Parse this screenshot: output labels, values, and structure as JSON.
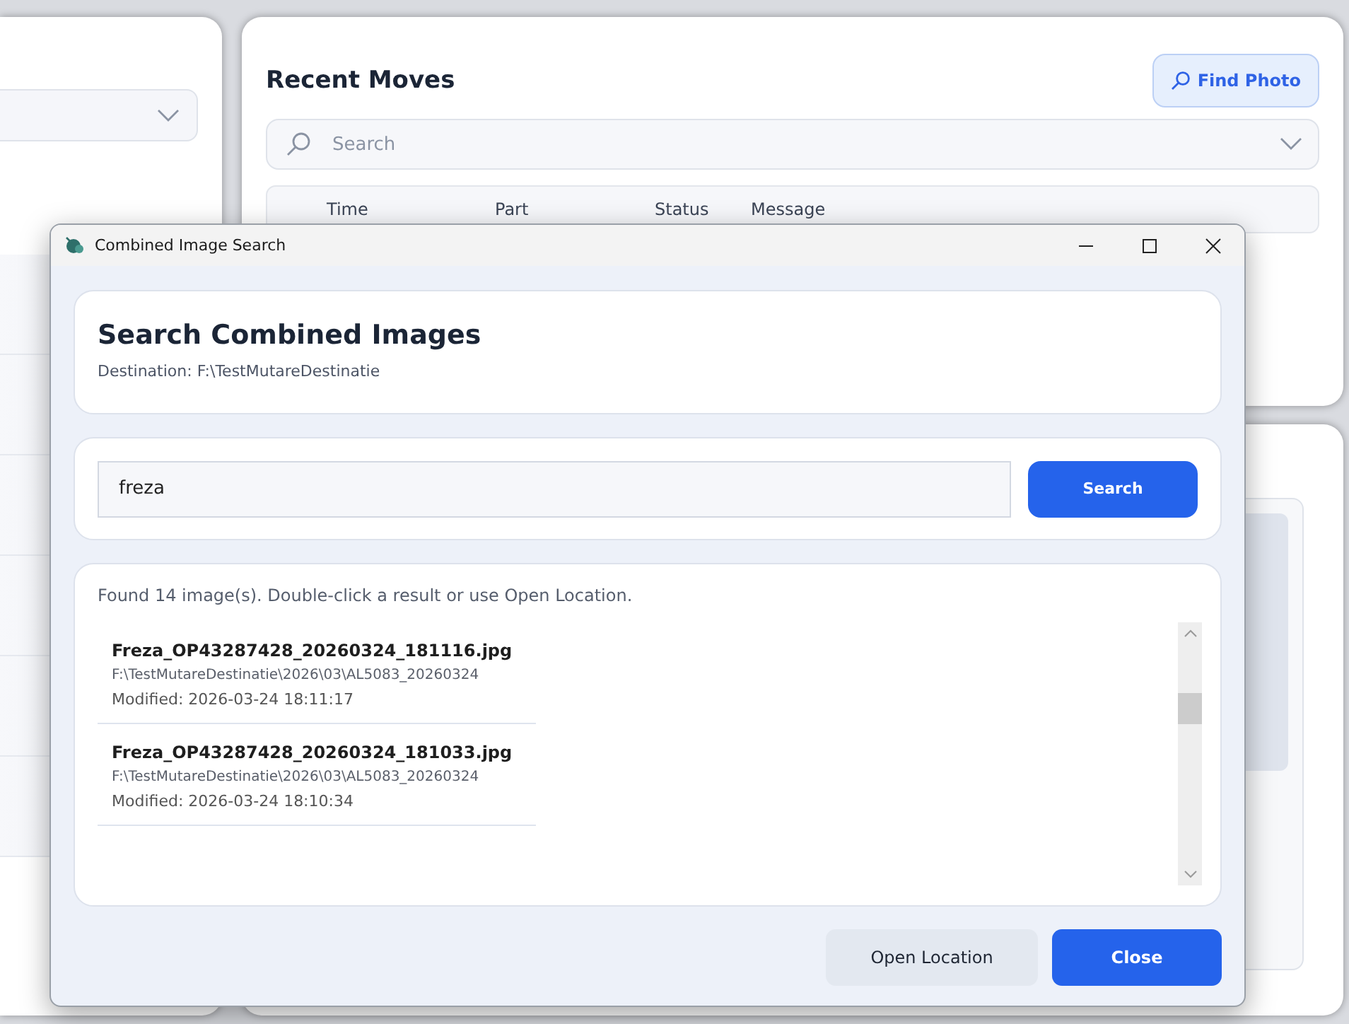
{
  "recent_moves": {
    "title": "Recent Moves",
    "find_button": "Find Photo",
    "search": {
      "placeholder": "Search"
    },
    "columns": [
      "Time",
      "Part",
      "Status",
      "Message"
    ]
  },
  "dialog": {
    "title": "Combined Image Search",
    "heading": "Search Combined Images",
    "destination": "Destination: F:\\TestMutareDestinatie",
    "query": "freza",
    "search_button": "Search",
    "summary": "Found 14 image(s). Double-click a result or use Open Location.",
    "results": [
      {
        "name": "Freza_OP43287428_20260324_181116.jpg",
        "path": "F:\\TestMutareDestinatie\\2026\\03\\AL5083_20260324",
        "modified": "Modified: 2026-03-24 18:11:17"
      },
      {
        "name": "Freza_OP43287428_20260324_181033.jpg",
        "path": "F:\\TestMutareDestinatie\\2026\\03\\AL5083_20260324",
        "modified": "Modified: 2026-03-24 18:10:34"
      }
    ],
    "buttons": [
      {
        "label": "Open Location",
        "kind": "secondary"
      },
      {
        "label": "Close",
        "kind": "primary"
      }
    ]
  }
}
